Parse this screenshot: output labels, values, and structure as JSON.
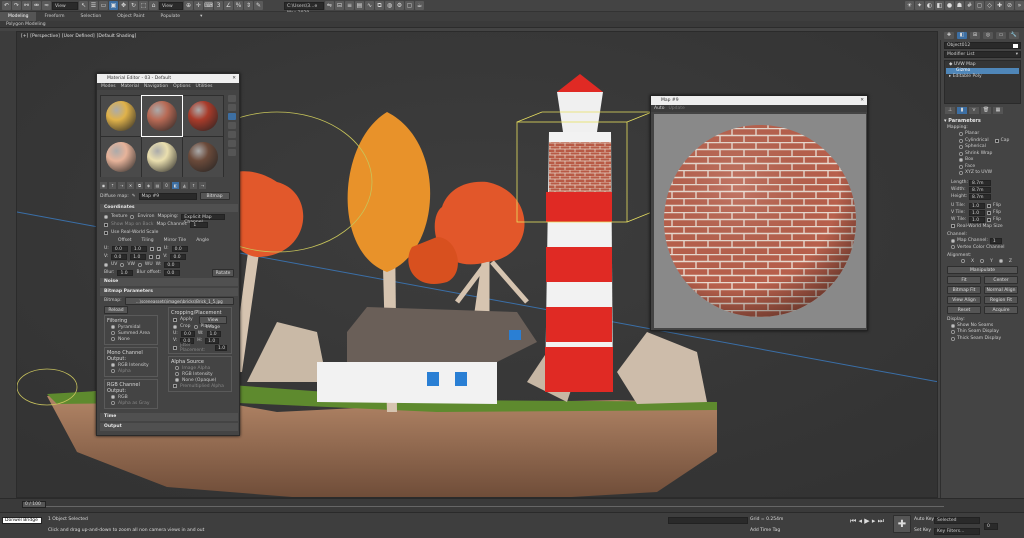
{
  "toolbar": {
    "view_dropdown": "View",
    "selection_set": "C:\\Users\\3...e Max 2020"
  },
  "ribbon": {
    "tabs": [
      "Modeling",
      "Freeform",
      "Selection",
      "Object Paint",
      "Populate"
    ],
    "active_tab": "Modeling",
    "sub_label": "Polygon Modeling"
  },
  "viewport": {
    "label_parts": [
      "[+]",
      "[Perspective]",
      "[User Defined]",
      "[Default Shading]"
    ]
  },
  "material_editor": {
    "title": "Material Editor - 03 - Default",
    "menu": [
      "Modes",
      "Material",
      "Navigation",
      "Options",
      "Utilities"
    ],
    "slot_colors": [
      "#e0b24a",
      "#b86a55",
      "#a93b2a",
      "#e7b39a",
      "#eadfae",
      "#6b4a3a"
    ],
    "map_label": "Diffuse map:",
    "map_name": "Map #9",
    "map_type": "Bitmap",
    "coordinates_title": "Coordinates",
    "texture_label": "Texture",
    "environ_label": "Environ",
    "mapping_label": "Mapping:",
    "mapping_value": "Explicit Map Channel",
    "show_map_on_back": "Show Map on Back",
    "map_channel_label": "Map Channel:",
    "map_channel_value": "1",
    "use_real_world": "Use Real-World Scale",
    "offset_label": "Offset",
    "tiling_label": "Tiling",
    "mirror_tile_label": "Mirror Tile",
    "angle_label": "Angle",
    "u_label": "U:",
    "v_label": "V:",
    "w_label": "W:",
    "offset_u": "0.0",
    "offset_v": "0.0",
    "tiling_u": "1.0",
    "tiling_v": "1.0",
    "angle_u": "0.0",
    "angle_v": "0.0",
    "angle_w": "0.0",
    "uv": "UV",
    "vw": "VW",
    "wu": "WU",
    "blur_label": "Blur:",
    "blur_value": "1.0",
    "blur_offset_label": "Blur offset:",
    "blur_offset_value": "0.0",
    "rotate": "Rotate",
    "noise_title": "Noise",
    "bitmap_params_title": "Bitmap Parameters",
    "bitmap_label": "Bitmap:",
    "bitmap_path": "...\\sceneassets\\images\\bricks\\Brick_1_5.jpg",
    "reload": "Reload",
    "cropping_title": "Cropping/Placement",
    "apply": "Apply",
    "view_image": "View Image",
    "crop": "Crop",
    "place": "Place",
    "crop_u": "0.0",
    "crop_v": "0.0",
    "crop_w": "1.0",
    "crop_h": "1.0",
    "jitter_label": "Jitter Placement:",
    "jitter_value": "1.0",
    "filtering_title": "Filtering",
    "pyramidal": "Pyramidal",
    "summed_area": "Summed Area",
    "none": "None",
    "mono_output_title": "Mono Channel Output:",
    "rgb_intensity": "RGB Intensity",
    "alpha": "Alpha",
    "rgb_output_title": "RGB Channel Output:",
    "rgb": "RGB",
    "alpha_as_gray": "Alpha as Gray",
    "alpha_source_title": "Alpha Source",
    "image_alpha": "Image Alpha",
    "rgb_intensity2": "RGB Intensity",
    "none_opaque": "None (Opaque)",
    "premultiplied_alpha": "Premultiplied Alpha",
    "time_title": "Time",
    "output_title": "Output"
  },
  "map_window": {
    "title": "Map #9",
    "tabs": [
      "Auto",
      "Update"
    ]
  },
  "command_panel": {
    "object_name": "Object012",
    "modifier_list": "Modifier List",
    "stack": [
      "UVW Map",
      "Gizmo",
      "Editable Poly"
    ],
    "selected_stack_item": "Gizmo",
    "parameters_title": "Parameters",
    "mapping_label": "Mapping:",
    "mapping_options": [
      "Planar",
      "Cylindrical",
      "Spherical",
      "Shrink Wrap",
      "Box",
      "Face",
      "XYZ to UVW"
    ],
    "selected_mapping": "Box",
    "cap_label": "Cap",
    "length_label": "Length:",
    "length_value": "8.7m",
    "width_label": "Width:",
    "width_value": "8.7m",
    "height_label": "Height:",
    "height_value": "8.7m",
    "u_tile_label": "U Tile:",
    "u_tile_value": "1.0",
    "v_tile_label": "V Tile:",
    "v_tile_value": "1.0",
    "w_tile_label": "W Tile:",
    "w_tile_value": "1.0",
    "flip_label": "Flip",
    "real_world": "Real-World Map Size",
    "channel_title": "Channel:",
    "map_channel": "Map Channel:",
    "map_channel_value": "1",
    "vertex_color": "Vertex Color Channel",
    "alignment_title": "Alignment:",
    "axes": [
      "X",
      "Y",
      "Z"
    ],
    "manipulate": "Manipulate",
    "buttons": [
      "Fit",
      "Center",
      "Bitmap Fit",
      "Normal Align",
      "View Align",
      "Region Fit",
      "Reset",
      "Acquire"
    ],
    "display_title": "Display:",
    "display_options": [
      "Show No Seams",
      "Thin Seam Display",
      "Thick Seam Display"
    ]
  },
  "timeline": {
    "frame_label": "0 / 100"
  },
  "status": {
    "script_label": "Donwel Bridge",
    "selected": "1 Object Selected",
    "prompt": "Click and drag up-and-down to zoom all non camera views in and out",
    "grid": "Grid = 0.254m",
    "add_time_tag": "Add Time Tag",
    "auto_key": "Auto Key",
    "set_key": "Set Key",
    "key_mode": "Selected",
    "key_filters": "Key Filters...",
    "frame": "0"
  },
  "colors": {
    "accent": "#3d6fa3",
    "selected_stack": "#4f86b8",
    "viewport_bg": "#393939"
  }
}
